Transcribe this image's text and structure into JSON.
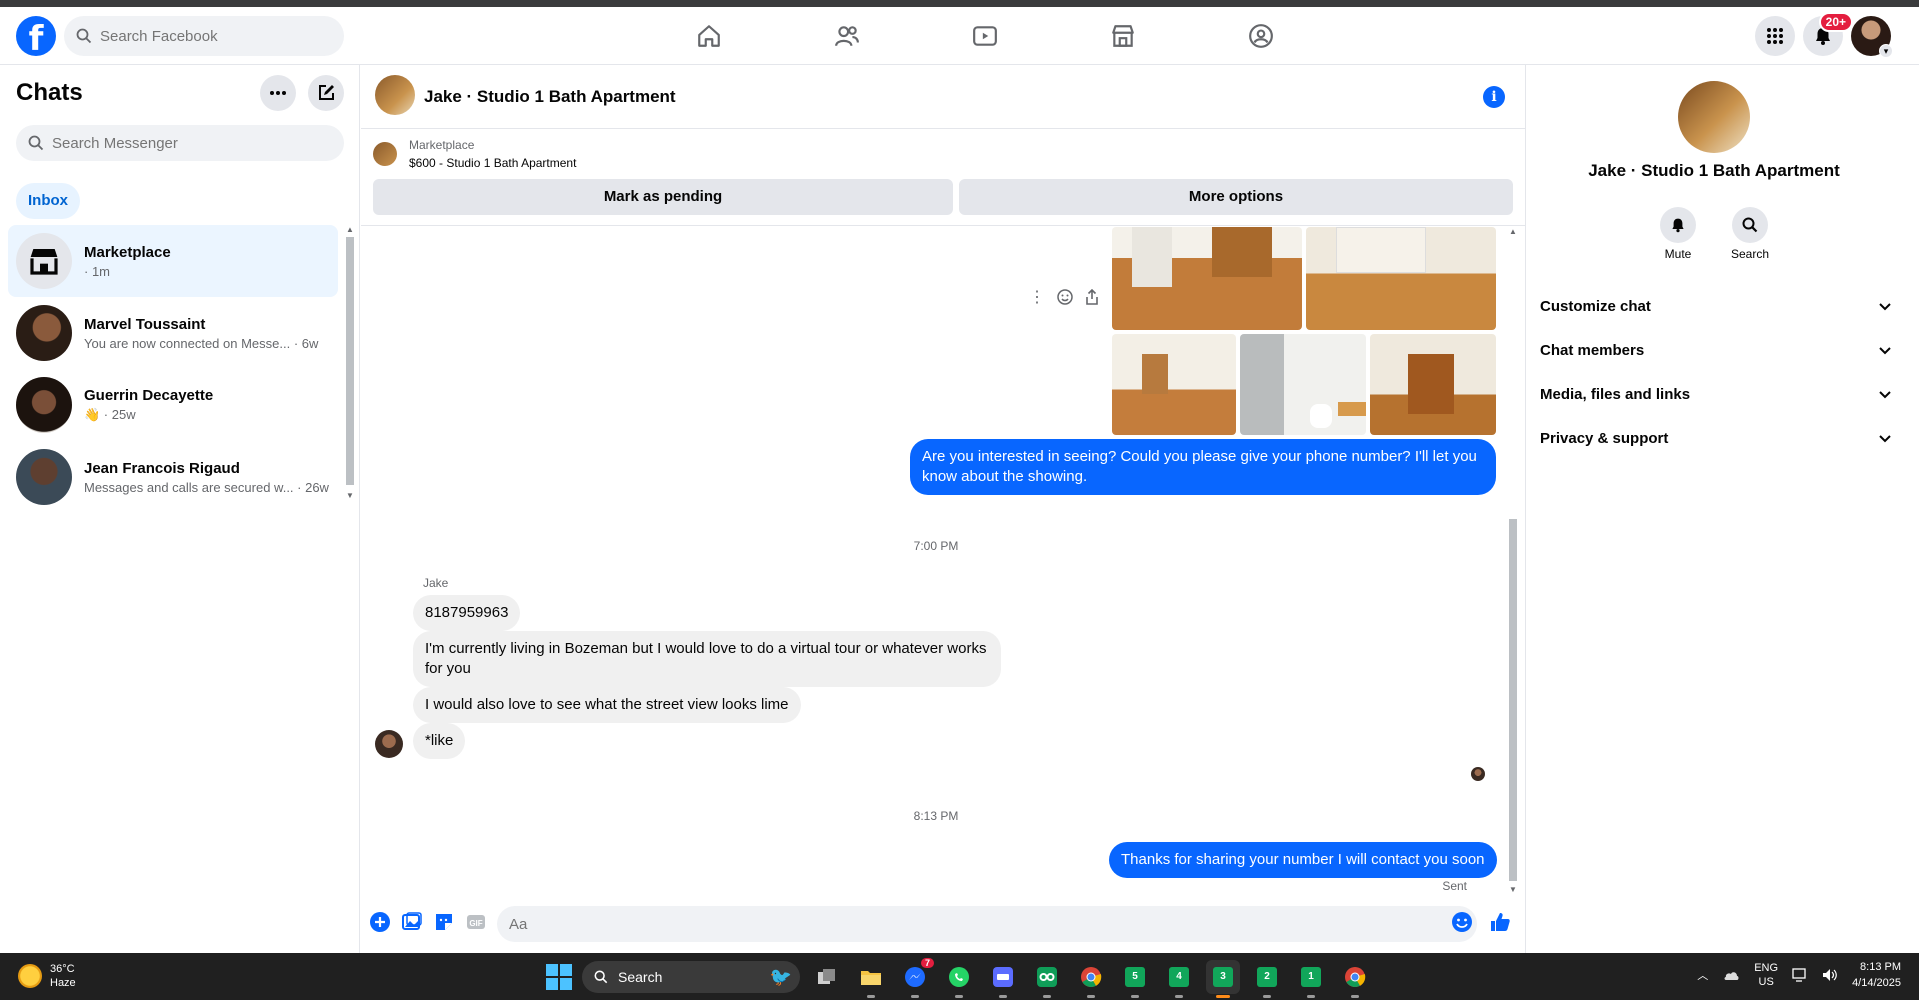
{
  "header": {
    "search_placeholder": "Search Facebook",
    "notification_badge": "20+"
  },
  "sidebar": {
    "title": "Chats",
    "search_placeholder": "Search Messenger",
    "filter_tab": "Inbox",
    "chats": [
      {
        "name": "Marketplace",
        "sub": "· 1m"
      },
      {
        "name": "Marvel Toussaint",
        "sub": "You are now connected on Messe... · 6w"
      },
      {
        "name": "Guerrin Decayette",
        "sub": "👋 · 25w"
      },
      {
        "name": "Jean Francois Rigaud",
        "sub": "Messages and calls are secured w... · 26w"
      }
    ]
  },
  "conversation": {
    "title": "Jake · Studio 1 Bath Apartment",
    "marketplace_label": "Marketplace",
    "listing": "$600 - Studio 1 Bath Apartment",
    "mark_pending": "Mark as pending",
    "more_options": "More options",
    "messages": {
      "out1": "Are you interested in seeing? Could you please give your phone number? I'll let you know about the showing.",
      "time1": "7:00 PM",
      "sender": "Jake",
      "in1": "8187959963",
      "in2": "I'm currently living in Bozeman but I would love to do a virtual tour or whatever works for you",
      "in3": "I would also love to see what the street view looks lime",
      "in4": "*like",
      "time2": "8:13 PM",
      "out2": "Thanks for sharing your number I will contact you soon",
      "status": "Sent"
    },
    "composer_placeholder": "Aa"
  },
  "right_panel": {
    "name": "Jake · Studio 1 Bath Apartment",
    "mute_label": "Mute",
    "search_label": "Search",
    "sections": [
      "Customize chat",
      "Chat members",
      "Media, files and links",
      "Privacy & support"
    ]
  },
  "taskbar": {
    "temperature": "36°C",
    "weather": "Haze",
    "search": "Search",
    "messenger_badge": "7",
    "apps": [
      "5",
      "4",
      "3",
      "2",
      "1"
    ],
    "language": "ENG",
    "region": "US",
    "time": "8:13 PM",
    "date": "4/14/2025"
  },
  "colors": {
    "brand": "#0866ff",
    "badge": "#e41e3f",
    "taskbar": "#202020"
  }
}
